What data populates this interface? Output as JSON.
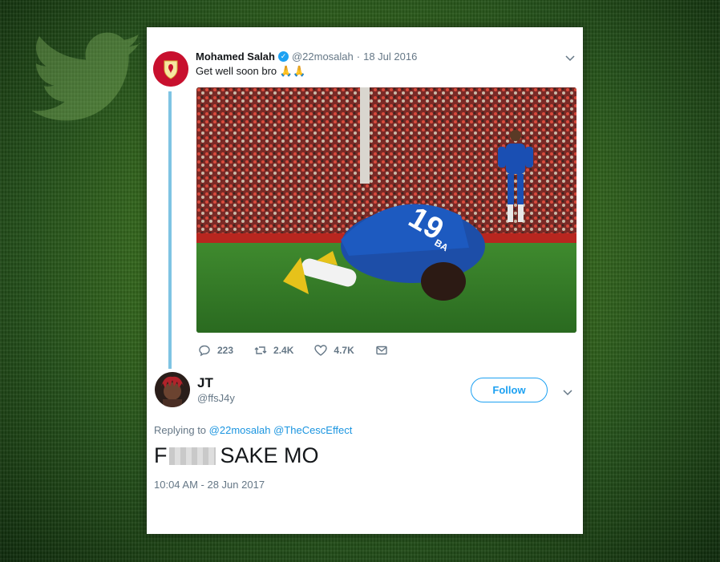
{
  "background": {
    "logo_icon": "twitter-bird-icon",
    "accent": "#1da1f2"
  },
  "original_tweet": {
    "author_name": "Mohamed Salah",
    "verified": true,
    "handle": "@22mosalah",
    "date_sep": "·",
    "date": "18 Jul 2016",
    "text": "Get well soon bro",
    "emoji": "🙏🙏",
    "media_icon": "photo-footballer-kneeling",
    "actions": {
      "reply_count": "223",
      "retweet_count": "2.4K",
      "like_count": "4.7K"
    }
  },
  "reply_tweet": {
    "author_name": "JT",
    "handle": "@ffsJ4y",
    "follow_label": "Follow",
    "replying_label": "Replying to",
    "mentions": [
      "@22mosalah",
      "@TheCescEffect"
    ],
    "text_prefix": "F",
    "text_suffix": "SAKE MO",
    "timestamp": "10:04 AM - 28 Jun 2017"
  }
}
